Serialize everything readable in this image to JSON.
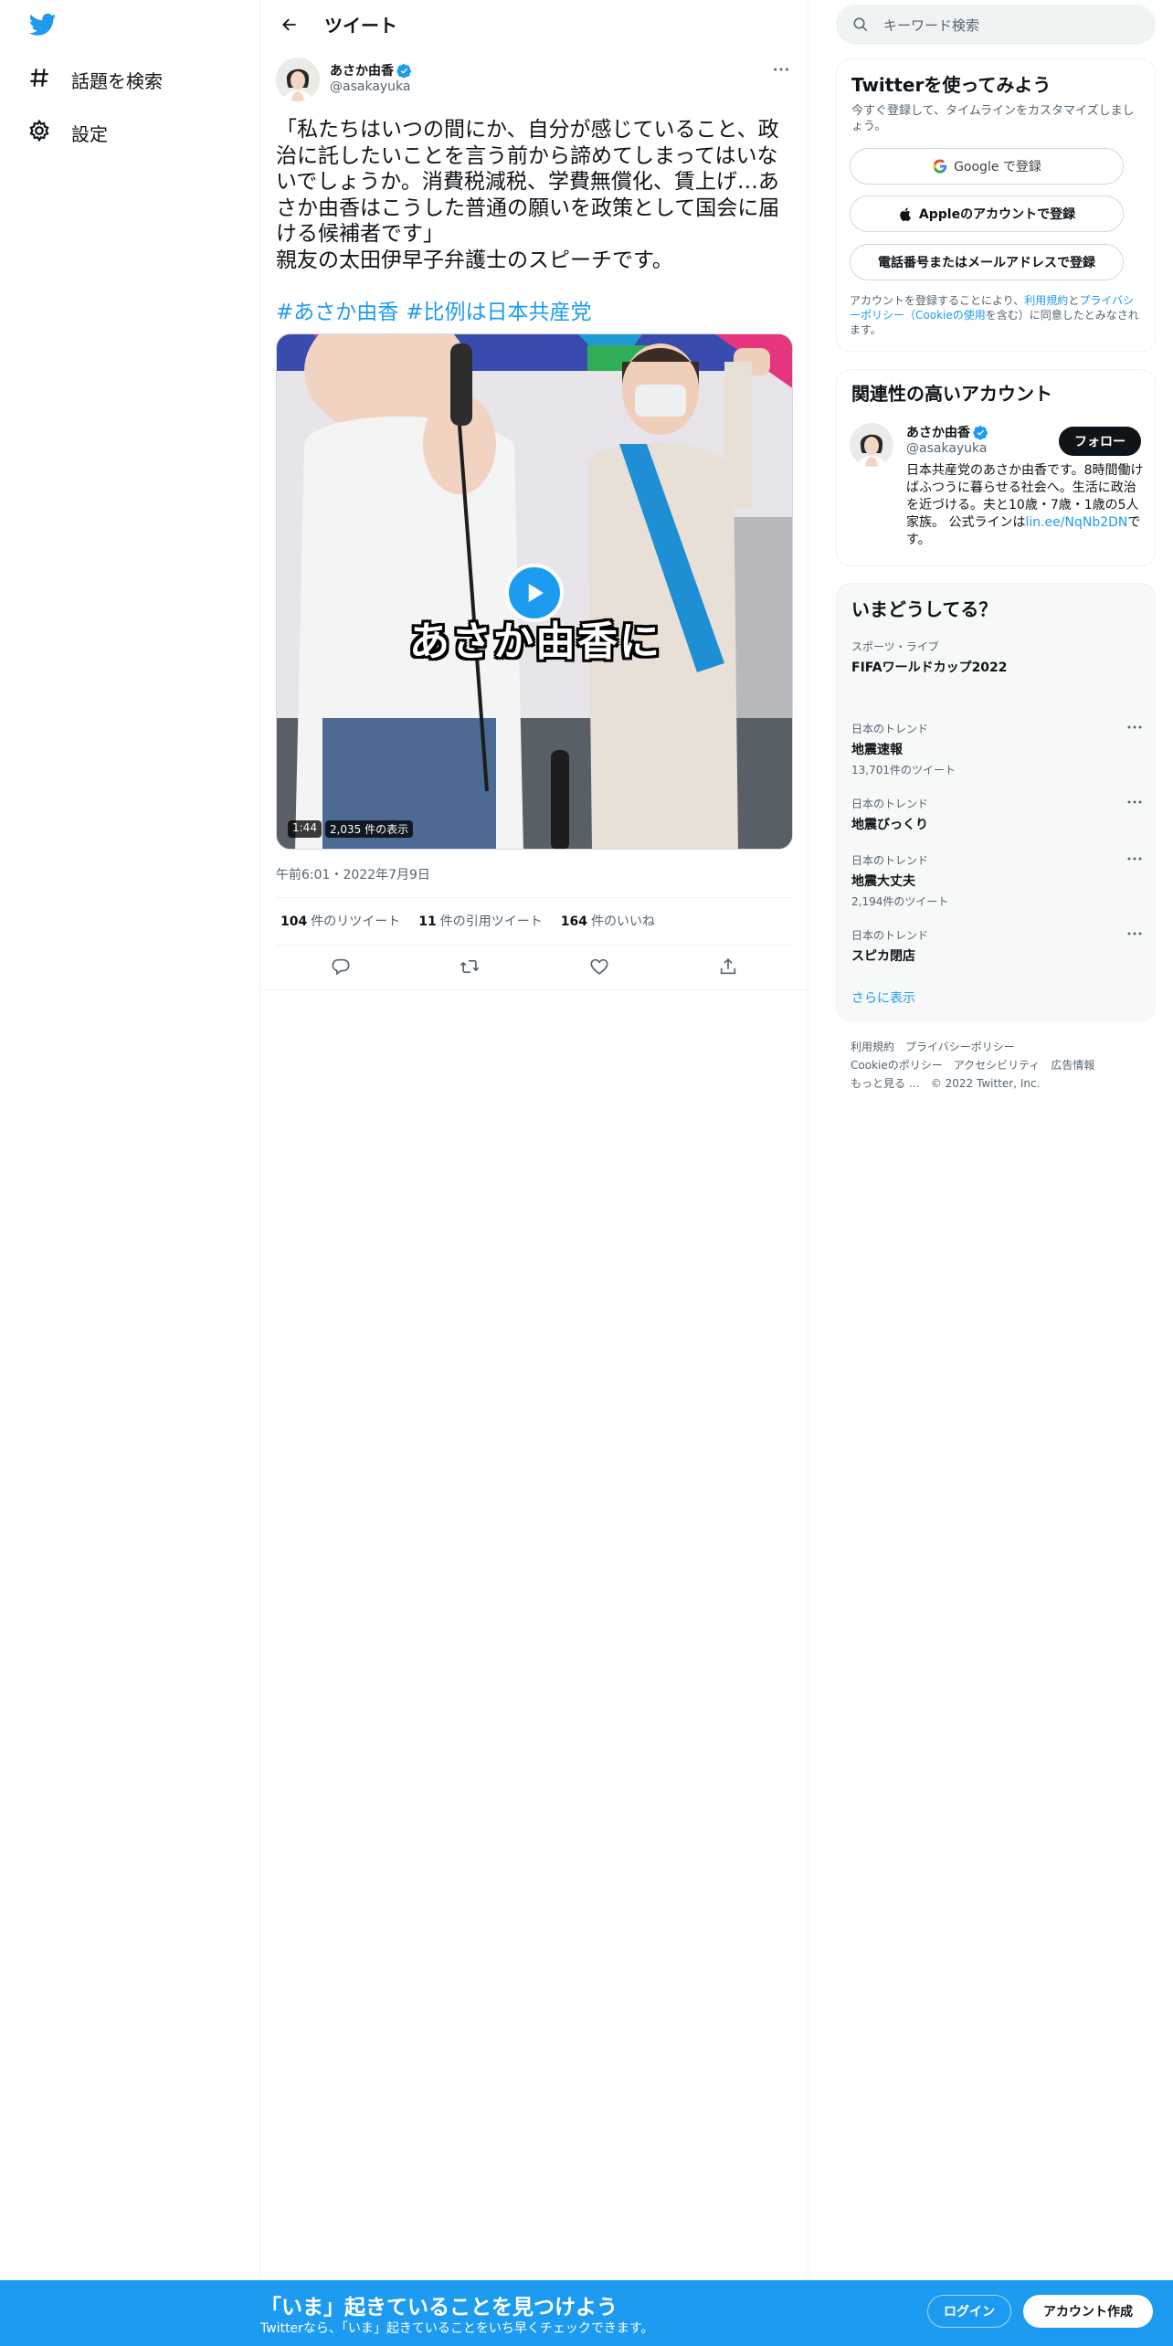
{
  "nav": {
    "items": [
      {
        "label": "話題を検索",
        "icon": "hashtag-icon"
      },
      {
        "label": "設定",
        "icon": "gear-icon"
      }
    ]
  },
  "header": {
    "title": "ツイート"
  },
  "tweet": {
    "author_name": "あさか由香",
    "author_handle": "@asakayuka",
    "text": "「私たちはいつの間にか、自分が感じていること、政治に託したいことを言う前から諦めてしまってはいないでしょうか。消費税減税、学費無償化、賃上げ…あさか由香はこうした普通の願いを政策として国会に届ける候補者です」\n親友の太田伊早子弁護士のスピーチです。",
    "hashtags": [
      "#あさか由香",
      "#比例は日本共産党"
    ],
    "video": {
      "caption": "あさか由香に",
      "duration": "1:44",
      "views": "2,035 件の表示"
    },
    "timestamp": "午前6:01・2022年7月9日",
    "stats": [
      {
        "count": "104",
        "label": "件のリツイート"
      },
      {
        "count": "11",
        "label": "件の引用ツイート"
      },
      {
        "count": "164",
        "label": "件のいいね"
      }
    ]
  },
  "search": {
    "placeholder": "キーワード検索"
  },
  "signup": {
    "title": "Twitterを使ってみよう",
    "subtitle": "今すぐ登録して、タイムラインをカスタマイズしましょう。",
    "google": "Google で登録",
    "apple": "Appleのアカウントで登録",
    "phone": "電話番号またはメールアドレスで登録",
    "terms_pre": "アカウントを登録することにより、",
    "terms_link1": "利用規約",
    "terms_mid": "と",
    "terms_link2": "プライバシーポリシー（Cookieの使用",
    "terms_post": "を含む）に同意したとみなされます。"
  },
  "related": {
    "title": "関連性の高いアカウント",
    "name": "あさか由香",
    "handle": "@asakayuka",
    "follow": "フォロー",
    "bio_pre": "日本共産党のあさか由香です。8時間働けばふつうに暮らせる社会へ。生活に政治を近づける。夫と10歳・7歳・1歳の5人家族。 公式ラインは",
    "bio_link": "lin.ee/NqNb2DN",
    "bio_post": "です。"
  },
  "trends": {
    "title": "いまどうしてる？",
    "items": [
      {
        "category": "スポーツ・ライブ",
        "name": "FIFAワールドカップ2022",
        "count": ""
      },
      {
        "category": "日本のトレンド",
        "name": "地震速報",
        "count": "13,701件のツイート"
      },
      {
        "category": "日本のトレンド",
        "name": "地震びっくり",
        "count": ""
      },
      {
        "category": "日本のトレンド",
        "name": "地震大丈夫",
        "count": "2,194件のツイート"
      },
      {
        "category": "日本のトレンド",
        "name": "スピカ閉店",
        "count": ""
      }
    ],
    "show_more": "さらに表示"
  },
  "footer": {
    "links": [
      "利用規約",
      "プライバシーポリシー",
      "Cookieのポリシー",
      "アクセシビリティ",
      "広告情報",
      "もっと見る …"
    ],
    "copyright": "© 2022 Twitter, Inc."
  },
  "banner": {
    "title": "「いま」起きていることを見つけよう",
    "subtitle": "Twitterなら、「いま」起きていることをいち早くチェックできます。",
    "login": "ログイン",
    "signup": "アカウント作成"
  },
  "colors": {
    "accent": "#1d9bf0",
    "text": "#0f1419",
    "muted": "#536471"
  }
}
